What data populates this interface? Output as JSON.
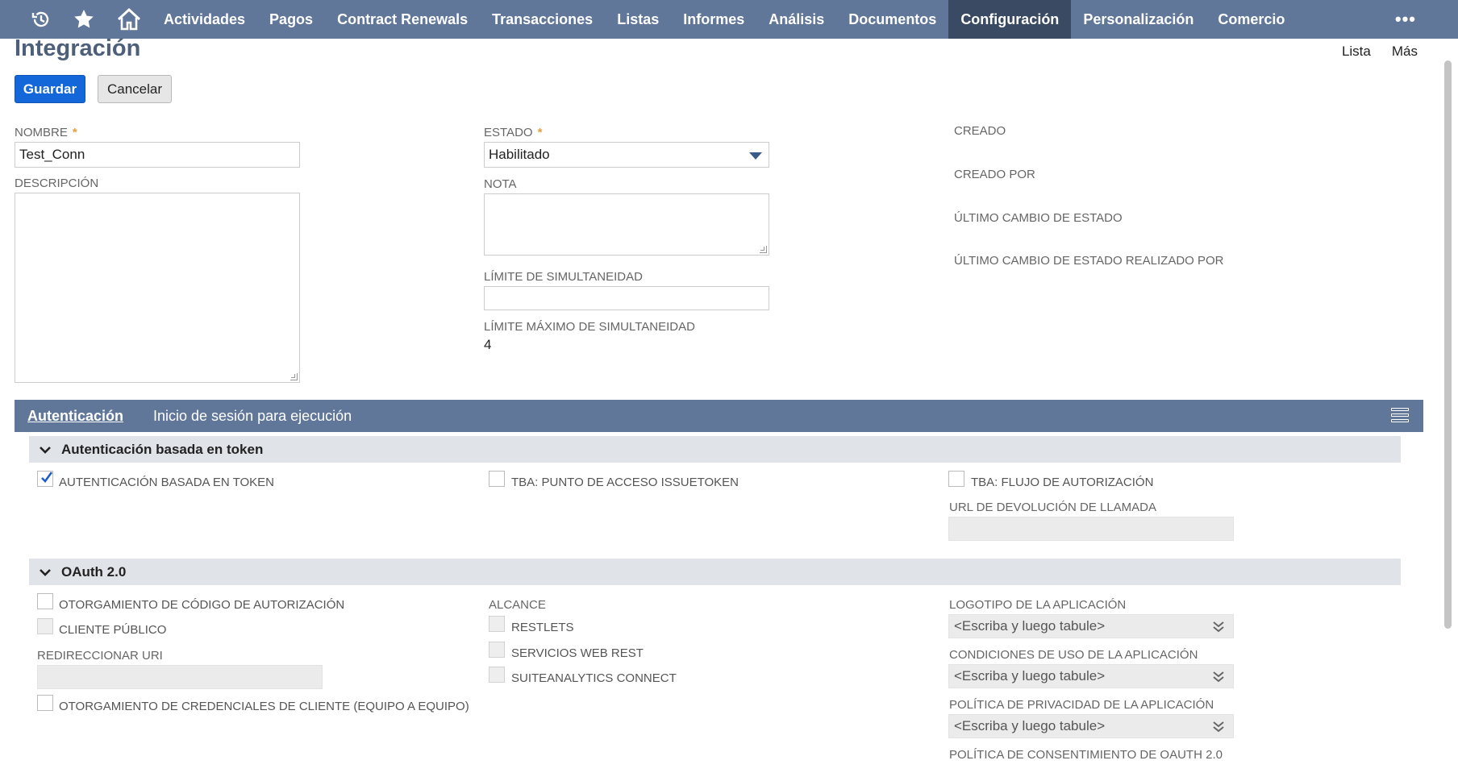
{
  "nav": {
    "items": [
      "Actividades",
      "Pagos",
      "Contract Renewals",
      "Transacciones",
      "Listas",
      "Informes",
      "Análisis",
      "Documentos",
      "Configuración",
      "Personalización",
      "Comercio"
    ],
    "active": "Configuración",
    "more_label": "•••"
  },
  "header": {
    "title": "Integración",
    "links": {
      "list": "Lista",
      "more": "Más"
    },
    "save_label": "Guardar",
    "cancel_label": "Cancelar"
  },
  "form": {
    "name_label": "NOMBRE",
    "name_value": "Test_Conn",
    "description_label": "DESCRIPCIÓN",
    "state_label": "ESTADO",
    "state_value": "Habilitado",
    "note_label": "NOTA",
    "concurrency_label": "LÍMITE DE SIMULTANEIDAD",
    "max_concurrency_label": "LÍMITE MÁXIMO DE SIMULTANEIDAD",
    "max_concurrency_value": "4",
    "created_label": "CREADO",
    "created_by_label": "CREADO POR",
    "last_state_change_label": "ÚLTIMO CAMBIO DE ESTADO",
    "last_state_change_by_label": "ÚLTIMO CAMBIO DE ESTADO REALIZADO POR",
    "required_mark": "*"
  },
  "tabs": {
    "items": [
      "Autenticación",
      "Inicio de sesión para ejecución"
    ],
    "active": "Autenticación"
  },
  "tba": {
    "title": "Autenticación basada en token",
    "token_auth": {
      "label": "AUTENTICACIÓN BASADA EN TOKEN",
      "checked": true
    },
    "issuetoken": {
      "label": "TBA: PUNTO DE ACCESO ISSUETOKEN",
      "checked": false
    },
    "auth_flow": {
      "label": "TBA: FLUJO DE AUTORIZACIÓN",
      "checked": false
    },
    "callback_url_label": "URL DE DEVOLUCIÓN DE LLAMADA"
  },
  "oauth": {
    "title": "OAuth 2.0",
    "auth_code_grant": "OTORGAMIENTO DE CÓDIGO DE AUTORIZACIÓN",
    "public_client": "CLIENTE PÚBLICO",
    "redirect_uri_label": "REDIRECCIONAR URI",
    "client_credentials": "OTORGAMIENTO DE CREDENCIALES DE CLIENTE (EQUIPO A EQUIPO)",
    "scope_label": "ALCANCE",
    "scope_restlets": "RESTLETS",
    "scope_rest": "SERVICIOS WEB REST",
    "scope_suiteanalytics": "SUITEANALYTICS CONNECT",
    "app_logo_label": "LOGOTIPO DE LA APLICACIÓN",
    "terms_label": "CONDICIONES DE USO DE LA APLICACIÓN",
    "privacy_label": "POLÍTICA DE PRIVACIDAD DE LA APLICACIÓN",
    "consent_label": "POLÍTICA DE CONSENTIMIENTO DE OAUTH 2.0",
    "select_placeholder": "<Escriba y luego tabule>"
  },
  "colors": {
    "nav_bg": "#607799",
    "nav_active": "#3b4a63",
    "primary_button": "#1467d8",
    "title": "#4d5f79",
    "section_bg": "#e0e3e8"
  }
}
